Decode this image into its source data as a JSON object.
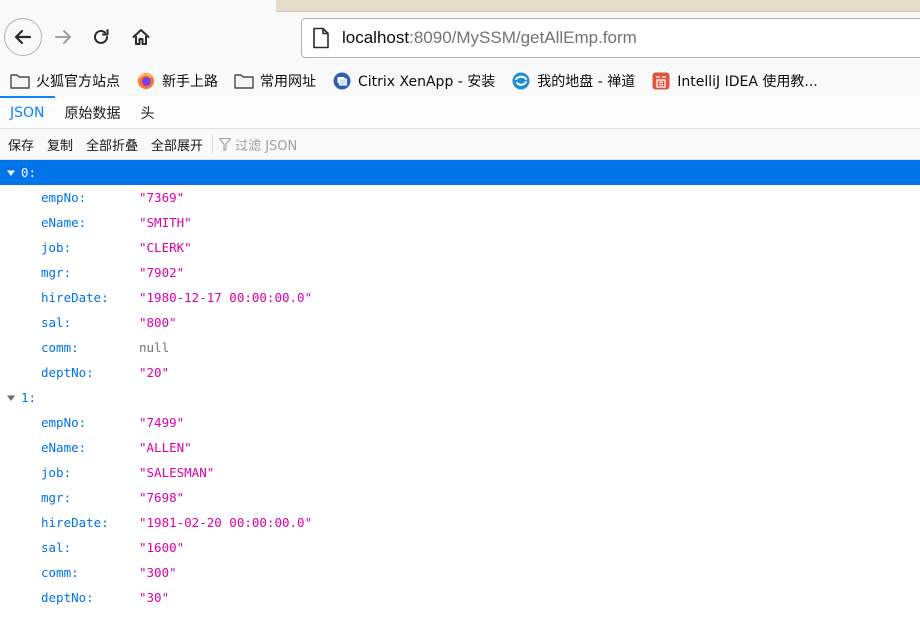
{
  "browser": {
    "url_host": "localhost",
    "url_rest": ":8090/MySSM/getAllEmp.form"
  },
  "bookmarks": [
    {
      "icon": "folder-icon",
      "label": "火狐官方站点"
    },
    {
      "icon": "firefox-icon",
      "label": "新手上路"
    },
    {
      "icon": "folder-icon",
      "label": "常用网址"
    },
    {
      "icon": "citrix-icon",
      "label": "Citrix XenApp - 安装"
    },
    {
      "icon": "zentao-icon",
      "label": "我的地盘 - 禅道"
    },
    {
      "icon": "jian-icon",
      "label": "IntelliJ IDEA 使用教..."
    }
  ],
  "viewer": {
    "tabs": [
      "JSON",
      "原始数据",
      "头"
    ],
    "active_tab": "JSON",
    "toolbar": {
      "save": "保存",
      "copy": "复制",
      "collapse_all": "全部折叠",
      "expand_all": "全部展开",
      "filter_placeholder": "过滤 JSON"
    }
  },
  "records": [
    {
      "key": "0:",
      "selected": true,
      "fields": [
        {
          "k": "empNo:",
          "v": "\"7369\""
        },
        {
          "k": "eName:",
          "v": "\"SMITH\""
        },
        {
          "k": "job:",
          "v": "\"CLERK\""
        },
        {
          "k": "mgr:",
          "v": "\"7902\""
        },
        {
          "k": "hireDate:",
          "v": "\"1980-12-17 00:00:00.0\""
        },
        {
          "k": "sal:",
          "v": "\"800\""
        },
        {
          "k": "comm:",
          "v": "null"
        },
        {
          "k": "deptNo:",
          "v": "\"20\""
        }
      ]
    },
    {
      "key": "1:",
      "selected": false,
      "fields": [
        {
          "k": "empNo:",
          "v": "\"7499\""
        },
        {
          "k": "eName:",
          "v": "\"ALLEN\""
        },
        {
          "k": "job:",
          "v": "\"SALESMAN\""
        },
        {
          "k": "mgr:",
          "v": "\"7698\""
        },
        {
          "k": "hireDate:",
          "v": "\"1981-02-20 00:00:00.0\""
        },
        {
          "k": "sal:",
          "v": "\"1600\""
        },
        {
          "k": "comm:",
          "v": "\"300\""
        },
        {
          "k": "deptNo:",
          "v": "\"30\""
        }
      ]
    }
  ],
  "colors": {
    "accent": "#0a84ff",
    "selected_row": "#0074e8",
    "key": "#0074e8",
    "string_value": "#dd00a9",
    "null_value": "#737373"
  }
}
